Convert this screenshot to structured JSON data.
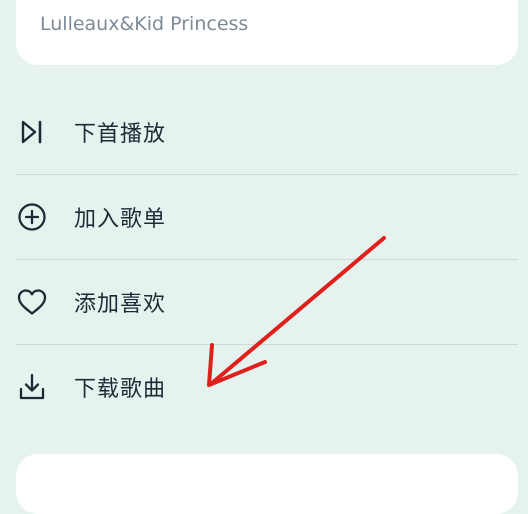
{
  "song": {
    "artist": "Lulleaux&Kid Princess"
  },
  "menu": {
    "items": [
      {
        "label": "下首播放",
        "icon": "skip-next-icon"
      },
      {
        "label": "加入歌单",
        "icon": "add-circle-icon"
      },
      {
        "label": "添加喜欢",
        "icon": "heart-icon"
      },
      {
        "label": "下载歌曲",
        "icon": "download-icon"
      }
    ]
  },
  "colors": {
    "background": "#E6F2EE",
    "card": "#FFFFFF",
    "text": "#1F2A36",
    "subtext": "#7D8B99",
    "divider": "#CFDAD6",
    "annotation_arrow": "#E0201C"
  }
}
